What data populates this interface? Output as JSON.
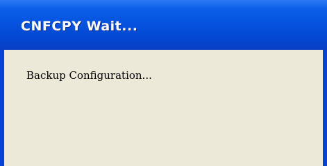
{
  "dialog": {
    "title": "CNFCPY Wait...",
    "message": "Backup Configuration..."
  },
  "colors": {
    "titlebar": "#0552de",
    "frame": "#0a3fd8",
    "client_background": "#ece9d8",
    "title_text": "#ffffff",
    "message_text": "#000000"
  }
}
